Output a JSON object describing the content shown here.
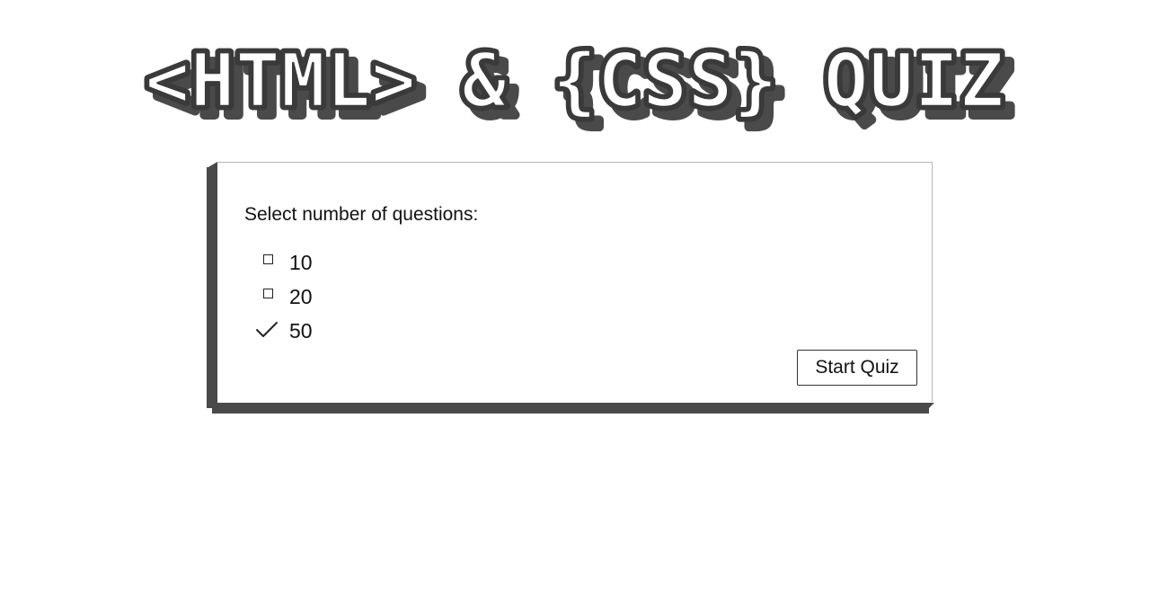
{
  "header": {
    "title": "<HTML> & {CSS} QUIZ"
  },
  "quiz_setup": {
    "prompt": "Select number of questions:",
    "options": [
      {
        "label": "10",
        "selected": false
      },
      {
        "label": "20",
        "selected": false
      },
      {
        "label": "50",
        "selected": true
      }
    ],
    "start_label": "Start Quiz"
  },
  "colors": {
    "shadow": "#4a4a4a",
    "text": "#111111",
    "background": "#ffffff"
  },
  "icons": {
    "unchecked": "square-icon",
    "checked": "checkmark-icon"
  }
}
